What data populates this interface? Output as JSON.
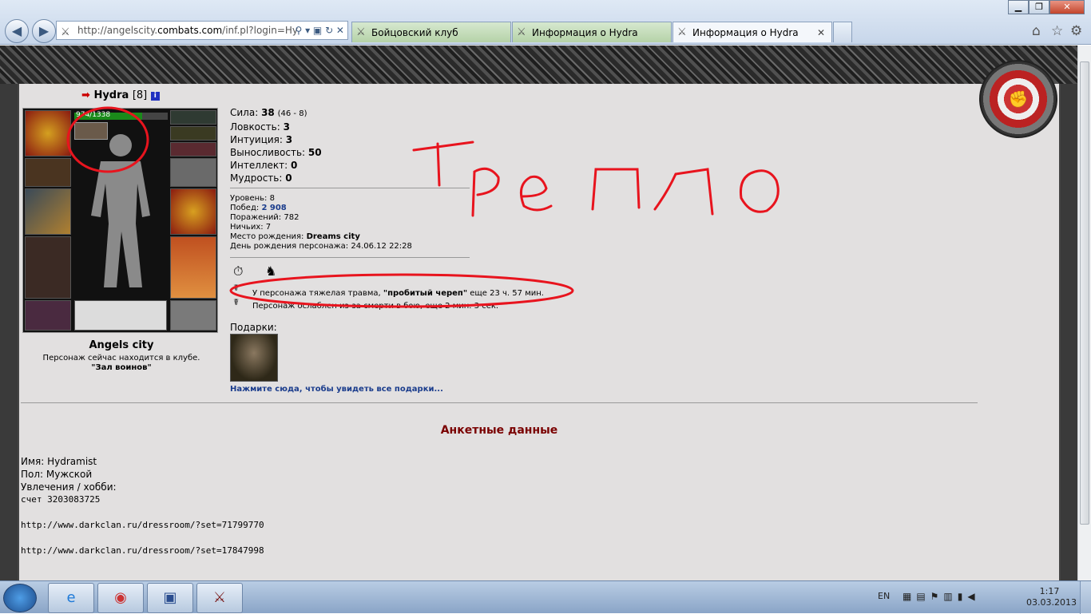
{
  "browser": {
    "url_prefix": "http://angelscity.",
    "url_domain": "combats.com",
    "url_suffix": "/inf.pl?login=Hy",
    "tabs": [
      {
        "label": "Бойцовский клуб"
      },
      {
        "label": "Информация о Hydra"
      },
      {
        "label": "Информация о Hydra"
      }
    ],
    "icons": [
      "back-icon",
      "forward-icon",
      "home-icon",
      "star-icon",
      "gear-icon"
    ]
  },
  "character": {
    "name": "Hydra",
    "level": "[8]",
    "hp": "974/1338",
    "hp_fraction": 0.728,
    "city": "Angels city",
    "location_line": "Персонаж сейчас находится в клубе.",
    "location_room": "\"Зал воинов\""
  },
  "stats": [
    {
      "label": "Сила:",
      "value": "38",
      "extra": "(46 - 8)"
    },
    {
      "label": "Ловкость:",
      "value": "3",
      "extra": ""
    },
    {
      "label": "Интуиция:",
      "value": "3",
      "extra": ""
    },
    {
      "label": "Выносливость:",
      "value": "50",
      "extra": ""
    },
    {
      "label": "Интеллект:",
      "value": "0",
      "extra": ""
    },
    {
      "label": "Мудрость:",
      "value": "0",
      "extra": ""
    }
  ],
  "info": {
    "level": "Уровень: 8",
    "wins_label": "Побед:",
    "wins": "2 908",
    "losses": "Поражений: 782",
    "draws": "Ничьих: 7",
    "birthplace_label": "Место рождения:",
    "birthplace": "Dreams city",
    "birthday": "День рождения персонажа: 24.06.12 22:28"
  },
  "effects": {
    "trauma_text": "У персонажа тяжелая травма,",
    "trauma_name": "\"пробитый череп\"",
    "trauma_time": "еще 23 ч. 57 мин.",
    "weakened_text": "Персонаж ослаблен из-за смерти в бою, еще 2 мин. 3 сек."
  },
  "gifts": {
    "label": "Подарки:",
    "link": "Нажмите сюда, чтобы увидеть все подарки..."
  },
  "profile": {
    "heading": "Анкетные данные",
    "name": "Имя: Hydramist",
    "gender": "Пол: Мужской",
    "hobby_label": "Увлечения / хобби:",
    "lines": [
      "счет 3203083725",
      "",
      "http://www.darkclan.ru/dressroom/?set=71799770",
      "",
      "http://www.darkclan.ru/dressroom/?set=17847998"
    ]
  },
  "annotation": {
    "text": "Трепло",
    "color": "#e8141e"
  },
  "taskbar": {
    "lang": "EN",
    "time": "1:17",
    "date": "03.03.2013"
  }
}
